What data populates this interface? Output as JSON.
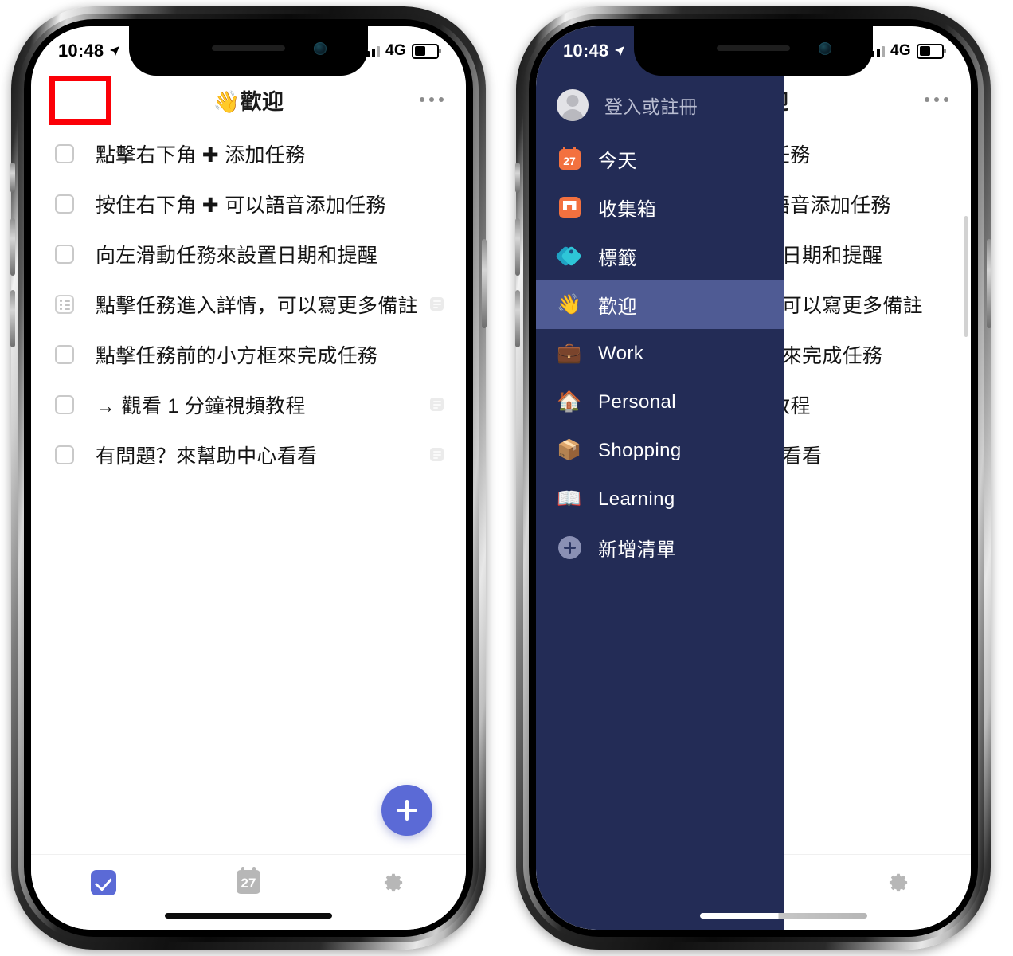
{
  "status_bar": {
    "time": "10:48",
    "location_icon": "location-arrow-icon",
    "network": "4G",
    "signal_icon": "signal-bars-icon",
    "battery_icon": "battery-icon"
  },
  "navbar": {
    "menu_icon": "hamburger-menu-icon",
    "title": "👋歡迎",
    "more_icon": "more-options-icon"
  },
  "tasks": [
    {
      "text": "點擊右下角 ✚ 添加任務",
      "icon": "checkbox-icon",
      "has_note": false
    },
    {
      "text": "按住右下角 ✚ 可以語音添加任務",
      "icon": "checkbox-icon",
      "has_note": false
    },
    {
      "text": "向左滑動任務來設置日期和提醒",
      "icon": "checkbox-icon",
      "has_note": false
    },
    {
      "text": "點擊任務進入詳情，可以寫更多備註",
      "icon": "checklist-icon",
      "has_note": true
    },
    {
      "text": "點擊任務前的小方框來完成任務",
      "icon": "checkbox-icon",
      "has_note": false
    },
    {
      "text": "→ 觀看 1 分鐘視頻教程",
      "icon": "checkbox-icon",
      "has_note": true
    },
    {
      "text": "有問題？來幫助中心看看",
      "icon": "checkbox-icon",
      "has_note": true
    }
  ],
  "fab": {
    "label": "+",
    "icon": "add-task-icon"
  },
  "tabbar": {
    "items": [
      {
        "name": "tasks",
        "icon": "checkmark-icon",
        "active": true
      },
      {
        "name": "calendar",
        "icon": "calendar-icon",
        "label": "27",
        "active": false
      },
      {
        "name": "settings",
        "icon": "gear-icon",
        "active": false
      }
    ]
  },
  "drawer": {
    "account_label": "登入或註冊",
    "account_icon": "avatar-icon",
    "items": [
      {
        "label": "今天",
        "icon": "calendar-icon",
        "icon_text": "27",
        "active": false
      },
      {
        "label": "收集箱",
        "icon": "inbox-icon",
        "active": false
      },
      {
        "label": "標籤",
        "icon": "tag-icon",
        "active": false
      },
      {
        "label": "歡迎",
        "icon": "wave-hand-emoji",
        "emoji": "👋",
        "active": true
      },
      {
        "label": "Work",
        "icon": "briefcase-emoji",
        "emoji": "💼",
        "active": false
      },
      {
        "label": "Personal",
        "icon": "house-emoji",
        "emoji": "🏠",
        "active": false
      },
      {
        "label": "Shopping",
        "icon": "package-emoji",
        "emoji": "📦",
        "active": false
      },
      {
        "label": "Learning",
        "icon": "open-book-emoji",
        "emoji": "📖",
        "active": false
      },
      {
        "label": "新增清單",
        "icon": "plus-circle-icon",
        "active": false
      }
    ]
  },
  "annotation": {
    "highlight_target": "hamburger-menu-icon",
    "highlight_color": "#fb0007"
  },
  "colors": {
    "accent": "#5b6ad6",
    "drawer_bg": "#232c56",
    "drawer_active": "#4f5b94",
    "icon_orange": "#f3713f",
    "icon_teal": "#2ec6d8"
  }
}
